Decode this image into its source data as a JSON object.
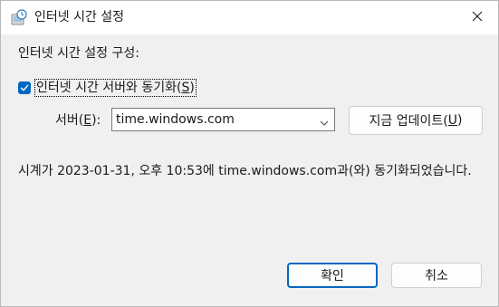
{
  "window": {
    "title": "인터넷 시간 설정",
    "app_icon": "clock-globe-icon",
    "close_icon": "close-icon"
  },
  "heading": "인터넷 시간 설정 구성:",
  "sync_checkbox": {
    "checked": true,
    "label_text": "인터넷 시간 서버와 동기화(",
    "mnemonic": "S",
    "label_suffix": ")"
  },
  "server": {
    "label_text": "서버(",
    "mnemonic": "E",
    "label_suffix": "):",
    "selected_value": "time.windows.com",
    "dropdown_icon": "chevron-down-icon"
  },
  "update_button": {
    "label_text": "지금 업데이트(",
    "mnemonic": "U",
    "label_suffix": ")"
  },
  "status_message": "시계가 2023-01-31, 오후 10:53에 time.windows.com과(와) 동기화되었습니다.",
  "buttons": {
    "ok": "확인",
    "cancel": "취소"
  },
  "colors": {
    "accent": "#0067c0",
    "dialog_background": "#f0f0f0",
    "titlebar_background": "#ffffff"
  }
}
